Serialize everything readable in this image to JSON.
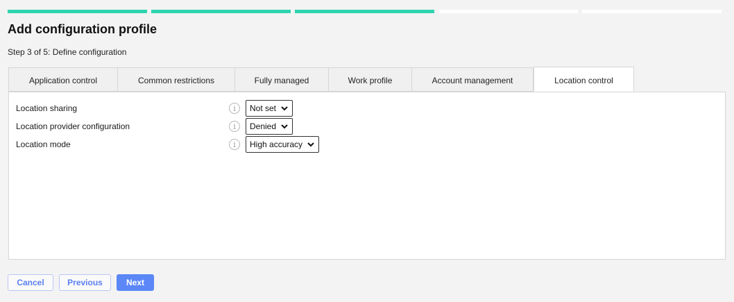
{
  "progress": {
    "total_steps": 5,
    "completed_steps": 3
  },
  "header": {
    "title": "Add configuration profile",
    "step": "Step 3 of 5: Define configuration"
  },
  "tabs": [
    {
      "label": "Application control",
      "active": false
    },
    {
      "label": "Common restrictions",
      "active": false
    },
    {
      "label": "Fully managed",
      "active": false
    },
    {
      "label": "Work profile",
      "active": false
    },
    {
      "label": "Account management",
      "active": false
    },
    {
      "label": "Location control",
      "active": true
    }
  ],
  "settings": [
    {
      "label": "Location sharing",
      "value": "Not set",
      "info_icon": "info-icon"
    },
    {
      "label": "Location provider configuration",
      "value": "Denied",
      "info_icon": "info-icon"
    },
    {
      "label": "Location mode",
      "value": "High accuracy",
      "info_icon": "info-icon"
    }
  ],
  "buttons": {
    "cancel": "Cancel",
    "previous": "Previous",
    "next": "Next"
  },
  "colors": {
    "progress_done": "#2ed3b0",
    "progress_pending": "#ffffff",
    "primary": "#5b87f7",
    "outline_text": "#5b7ff0"
  }
}
